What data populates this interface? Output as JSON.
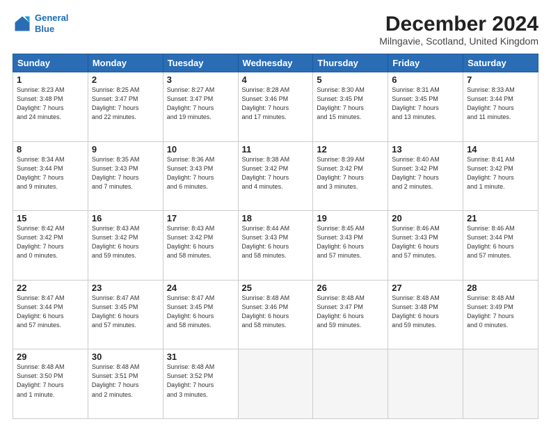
{
  "header": {
    "logo_line1": "General",
    "logo_line2": "Blue",
    "title": "December 2024",
    "subtitle": "Milngavie, Scotland, United Kingdom"
  },
  "calendar": {
    "days_of_week": [
      "Sunday",
      "Monday",
      "Tuesday",
      "Wednesday",
      "Thursday",
      "Friday",
      "Saturday"
    ],
    "weeks": [
      [
        {
          "day": "1",
          "info": "Sunrise: 8:23 AM\nSunset: 3:48 PM\nDaylight: 7 hours\nand 24 minutes."
        },
        {
          "day": "2",
          "info": "Sunrise: 8:25 AM\nSunset: 3:47 PM\nDaylight: 7 hours\nand 22 minutes."
        },
        {
          "day": "3",
          "info": "Sunrise: 8:27 AM\nSunset: 3:47 PM\nDaylight: 7 hours\nand 19 minutes."
        },
        {
          "day": "4",
          "info": "Sunrise: 8:28 AM\nSunset: 3:46 PM\nDaylight: 7 hours\nand 17 minutes."
        },
        {
          "day": "5",
          "info": "Sunrise: 8:30 AM\nSunset: 3:45 PM\nDaylight: 7 hours\nand 15 minutes."
        },
        {
          "day": "6",
          "info": "Sunrise: 8:31 AM\nSunset: 3:45 PM\nDaylight: 7 hours\nand 13 minutes."
        },
        {
          "day": "7",
          "info": "Sunrise: 8:33 AM\nSunset: 3:44 PM\nDaylight: 7 hours\nand 11 minutes."
        }
      ],
      [
        {
          "day": "8",
          "info": "Sunrise: 8:34 AM\nSunset: 3:44 PM\nDaylight: 7 hours\nand 9 minutes."
        },
        {
          "day": "9",
          "info": "Sunrise: 8:35 AM\nSunset: 3:43 PM\nDaylight: 7 hours\nand 7 minutes."
        },
        {
          "day": "10",
          "info": "Sunrise: 8:36 AM\nSunset: 3:43 PM\nDaylight: 7 hours\nand 6 minutes."
        },
        {
          "day": "11",
          "info": "Sunrise: 8:38 AM\nSunset: 3:42 PM\nDaylight: 7 hours\nand 4 minutes."
        },
        {
          "day": "12",
          "info": "Sunrise: 8:39 AM\nSunset: 3:42 PM\nDaylight: 7 hours\nand 3 minutes."
        },
        {
          "day": "13",
          "info": "Sunrise: 8:40 AM\nSunset: 3:42 PM\nDaylight: 7 hours\nand 2 minutes."
        },
        {
          "day": "14",
          "info": "Sunrise: 8:41 AM\nSunset: 3:42 PM\nDaylight: 7 hours\nand 1 minute."
        }
      ],
      [
        {
          "day": "15",
          "info": "Sunrise: 8:42 AM\nSunset: 3:42 PM\nDaylight: 7 hours\nand 0 minutes."
        },
        {
          "day": "16",
          "info": "Sunrise: 8:43 AM\nSunset: 3:42 PM\nDaylight: 6 hours\nand 59 minutes."
        },
        {
          "day": "17",
          "info": "Sunrise: 8:43 AM\nSunset: 3:42 PM\nDaylight: 6 hours\nand 58 minutes."
        },
        {
          "day": "18",
          "info": "Sunrise: 8:44 AM\nSunset: 3:43 PM\nDaylight: 6 hours\nand 58 minutes."
        },
        {
          "day": "19",
          "info": "Sunrise: 8:45 AM\nSunset: 3:43 PM\nDaylight: 6 hours\nand 57 minutes."
        },
        {
          "day": "20",
          "info": "Sunrise: 8:46 AM\nSunset: 3:43 PM\nDaylight: 6 hours\nand 57 minutes."
        },
        {
          "day": "21",
          "info": "Sunrise: 8:46 AM\nSunset: 3:44 PM\nDaylight: 6 hours\nand 57 minutes."
        }
      ],
      [
        {
          "day": "22",
          "info": "Sunrise: 8:47 AM\nSunset: 3:44 PM\nDaylight: 6 hours\nand 57 minutes."
        },
        {
          "day": "23",
          "info": "Sunrise: 8:47 AM\nSunset: 3:45 PM\nDaylight: 6 hours\nand 57 minutes."
        },
        {
          "day": "24",
          "info": "Sunrise: 8:47 AM\nSunset: 3:45 PM\nDaylight: 6 hours\nand 58 minutes."
        },
        {
          "day": "25",
          "info": "Sunrise: 8:48 AM\nSunset: 3:46 PM\nDaylight: 6 hours\nand 58 minutes."
        },
        {
          "day": "26",
          "info": "Sunrise: 8:48 AM\nSunset: 3:47 PM\nDaylight: 6 hours\nand 59 minutes."
        },
        {
          "day": "27",
          "info": "Sunrise: 8:48 AM\nSunset: 3:48 PM\nDaylight: 6 hours\nand 59 minutes."
        },
        {
          "day": "28",
          "info": "Sunrise: 8:48 AM\nSunset: 3:49 PM\nDaylight: 7 hours\nand 0 minutes."
        }
      ],
      [
        {
          "day": "29",
          "info": "Sunrise: 8:48 AM\nSunset: 3:50 PM\nDaylight: 7 hours\nand 1 minute."
        },
        {
          "day": "30",
          "info": "Sunrise: 8:48 AM\nSunset: 3:51 PM\nDaylight: 7 hours\nand 2 minutes."
        },
        {
          "day": "31",
          "info": "Sunrise: 8:48 AM\nSunset: 3:52 PM\nDaylight: 7 hours\nand 3 minutes."
        },
        {
          "day": "",
          "info": ""
        },
        {
          "day": "",
          "info": ""
        },
        {
          "day": "",
          "info": ""
        },
        {
          "day": "",
          "info": ""
        }
      ]
    ]
  }
}
